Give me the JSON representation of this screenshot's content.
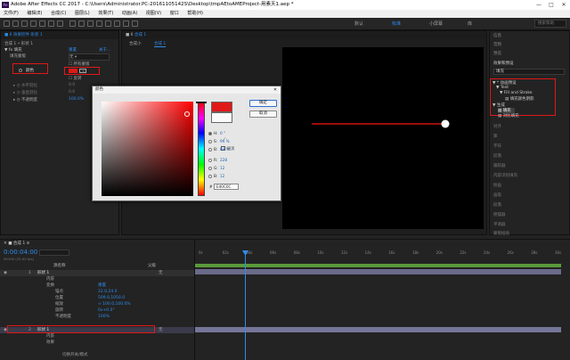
{
  "window": {
    "title": "Adobe After Effects CC 2017 - C:\\Users\\Administrator.PC-20161105142S\\Desktop\\tmpAEtoAMEProject-用素天1.aep *",
    "app_icon": "Ae",
    "minimize": "—",
    "maximize": "□",
    "close": "✕"
  },
  "menu": [
    "文件(F)",
    "编辑(E)",
    "合成(C)",
    "图层(L)",
    "效果(T)",
    "动画(A)",
    "视图(V)",
    "窗口",
    "帮助(H)"
  ],
  "workspaces": [
    {
      "label": "默认",
      "active": false
    },
    {
      "label": "标准",
      "active": true
    },
    {
      "label": "小屏幕",
      "active": false
    },
    {
      "label": "库",
      "active": false
    }
  ],
  "search": {
    "placeholder": "搜索帮助"
  },
  "left_panel": {
    "tab": "■ 6 效果控件 形状 1",
    "breadcrumb": "合成 1 • 形状 1",
    "effect_name": "填充",
    "reset": "重置",
    "about": "关于...",
    "fill_mask": "填充蒙版",
    "fill_mask_value": "无",
    "all_masks": "所有蒙版",
    "color": "颜色",
    "invert": "反转",
    "horizontal_feather": "水平羽化",
    "vertical_feather": "垂直羽化",
    "opacity": "不透明度",
    "opacity_value": "100.0%",
    "feather_value": "0.0"
  },
  "comp_panel": {
    "tabs": [
      "合成小",
      "合成 1"
    ],
    "tab_prefix": "■ 6"
  },
  "dialog": {
    "title": "颜色",
    "ok": "确定",
    "cancel": "取消",
    "checkbox": "网页",
    "hsb": [
      {
        "label": "H:",
        "value": "0 °"
      },
      {
        "label": "S:",
        "value": "94 %"
      },
      {
        "label": "B:",
        "value": "89 %"
      }
    ],
    "rgb": [
      {
        "label": "R:",
        "value": "228"
      },
      {
        "label": "G:",
        "value": "12"
      },
      {
        "label": "B:",
        "value": "12"
      }
    ],
    "hex_prefix": "#",
    "hex": "E40C0C",
    "selected_color": "#e40c0c",
    "previous_color": "#fafafa"
  },
  "right_panel": {
    "info": "信息",
    "audio": "音频",
    "preview": "预览",
    "effects_presets": "效果和预设",
    "search_placeholder": "填充",
    "tree": [
      "▼ * 动画预设",
      "▼ Text",
      "▼ Fill and Stroke",
      "填充颜色阴影",
      "▼ 生成",
      "填充",
      "对比填充"
    ],
    "items": [
      "对齐",
      "库",
      "字符",
      "段落",
      "跟踪器",
      "内容识别填充",
      "绘画",
      "画笔",
      "段落",
      "摇摆器",
      "平滑器",
      "蒙版插值"
    ]
  },
  "timeline": {
    "tab": "合成 1",
    "time": "0:00:04:00",
    "fps": "00100 (25.00 fps)",
    "columns": {
      "source": "源名称",
      "parent": "父级"
    },
    "rows": [
      {
        "indent": 0,
        "label": "形状 1",
        "num": "1"
      },
      {
        "indent": 1,
        "label": "内容"
      },
      {
        "indent": 1,
        "label": "变换",
        "extra": "重置"
      },
      {
        "indent": 2,
        "label": "锚点",
        "extra": "22.0,24.0"
      },
      {
        "indent": 2,
        "label": "位置",
        "extra": "509.0,1050.0"
      },
      {
        "indent": 2,
        "label": "缩放",
        "extra": "∞ 100.0,100.0%"
      },
      {
        "indent": 2,
        "label": "旋转",
        "extra": "0x+0.0°"
      },
      {
        "indent": 2,
        "label": "不透明度",
        "extra": "100%"
      },
      {
        "indent": 0,
        "label": "形状 1",
        "num": "2"
      },
      {
        "indent": 1,
        "label": "内容"
      },
      {
        "indent": 1,
        "label": "效果"
      }
    ],
    "parent_none": "无",
    "ruler": [
      "0s",
      "02s",
      "04s",
      "06s",
      "08s",
      "10s",
      "12s",
      "14s",
      "16s",
      "18s",
      "20s",
      "22s",
      "24s",
      "26s",
      "28s",
      "30s"
    ],
    "footer": "切换开关/模式"
  },
  "colors": {
    "accent": "#2d8ceb",
    "red": "#e01818",
    "playhead": "#2d8ceb",
    "layer_bar": "#757599"
  }
}
